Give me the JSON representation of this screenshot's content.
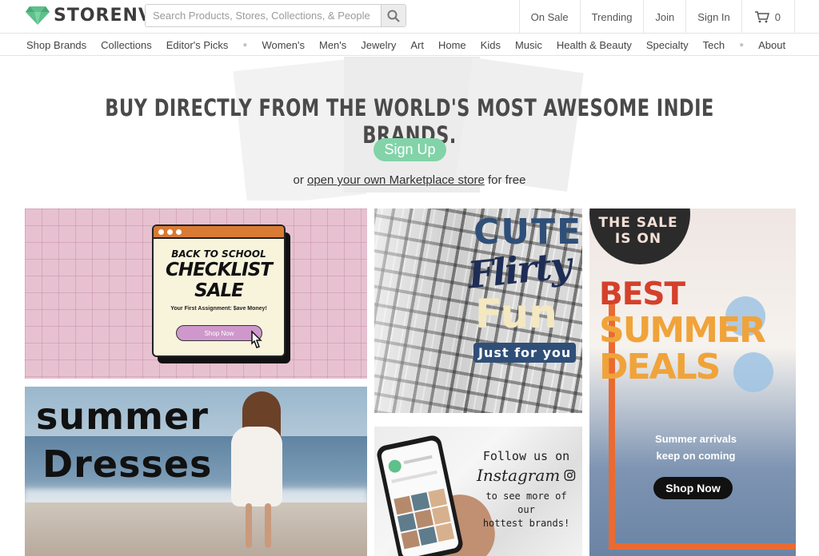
{
  "header": {
    "logo_text": "STORENVY",
    "search_placeholder": "Search Products, Stores, Collections, & People",
    "links": [
      "On Sale",
      "Trending",
      "Join",
      "Sign In"
    ],
    "cart_count": "0"
  },
  "nav": {
    "group1": [
      "Shop Brands",
      "Collections",
      "Editor's Picks"
    ],
    "group2": [
      "Women's",
      "Men's",
      "Jewelry",
      "Art",
      "Home",
      "Kids",
      "Music",
      "Health & Beauty",
      "Specialty",
      "Tech"
    ],
    "group3": [
      "About"
    ]
  },
  "hero": {
    "title": "BUY DIRECTLY FROM THE WORLD'S MOST AWESOME INDIE BRANDS.",
    "signup_label": "Sign Up",
    "sub_prefix": "or",
    "sub_link": "open your own Marketplace store",
    "sub_suffix": "for free"
  },
  "tiles": {
    "back_to_school": {
      "line1": "BACK TO SCHOOL",
      "line2": "CHECKLIST",
      "line3": "SALE",
      "tagline": "Your First Assignment: $ave Money!",
      "button": "Shop Now"
    },
    "cute_flirty": {
      "line1": "CUTE",
      "line2": "Flirty",
      "line3": "Fun",
      "line4": "Just for you"
    },
    "summer_deals": {
      "badge": "THE SALE IS ON",
      "line1": "BEST",
      "line2": "SUMMER",
      "line3": "DEALS",
      "text1": "Summer arrivals",
      "text2": "keep on coming",
      "button": "Shop Now"
    },
    "summer_dresses": {
      "line1": "summer",
      "line2": "Dresses"
    },
    "instagram": {
      "line1": "Follow us on",
      "brand": "Instagram",
      "line2": "to see more of our",
      "line3": "hottest brands!"
    }
  },
  "colors": {
    "brand_green": "#5ec08b",
    "signup_green": "#82d3a8",
    "sale_orange": "#ea6a32"
  }
}
